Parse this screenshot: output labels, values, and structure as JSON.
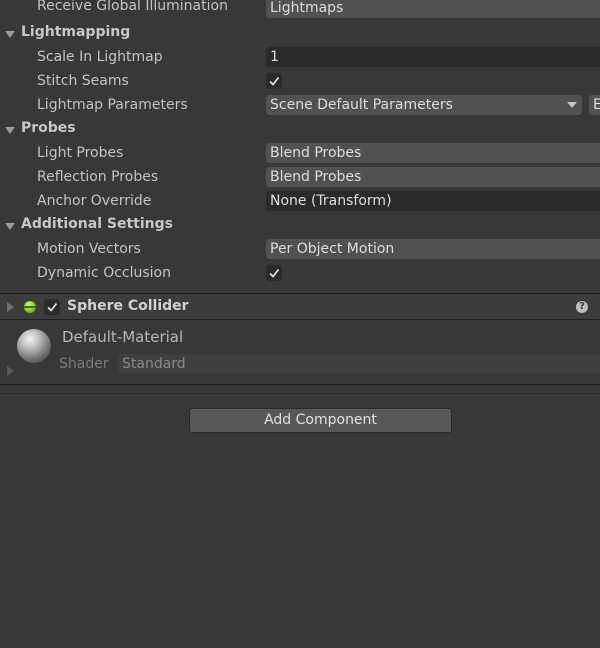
{
  "rows": {
    "receive_gi": {
      "label": "Receive Global Illumination",
      "value": "Lightmaps"
    },
    "lightmapping": {
      "title": "Lightmapping"
    },
    "scale_in_lightmap": {
      "label": "Scale In Lightmap",
      "value": "1"
    },
    "stitch_seams": {
      "label": "Stitch Seams",
      "checked": true
    },
    "lightmap_params": {
      "label": "Lightmap Parameters",
      "value": "Scene Default Parameters",
      "extra": "E"
    },
    "probes": {
      "title": "Probes"
    },
    "light_probes": {
      "label": "Light Probes",
      "value": "Blend Probes"
    },
    "reflection_probes": {
      "label": "Reflection Probes",
      "value": "Blend Probes"
    },
    "anchor_override": {
      "label": "Anchor Override",
      "value": "None (Transform)"
    },
    "additional": {
      "title": "Additional Settings"
    },
    "motion_vectors": {
      "label": "Motion Vectors",
      "value": "Per Object Motion"
    },
    "dynamic_occlusion": {
      "label": "Dynamic Occlusion",
      "checked": true
    }
  },
  "component": {
    "title": "Sphere Collider",
    "enabled": true,
    "help": "?",
    "menu": "⋮"
  },
  "material": {
    "name": "Default-Material",
    "shader_label": "Shader",
    "shader_value": "Standard"
  },
  "add_component": {
    "label": "Add Component"
  },
  "colors": {
    "background": "#383838",
    "field": "#515151",
    "check_bg": "#2c2c2c",
    "sphere_icon": "#8fd02a"
  }
}
